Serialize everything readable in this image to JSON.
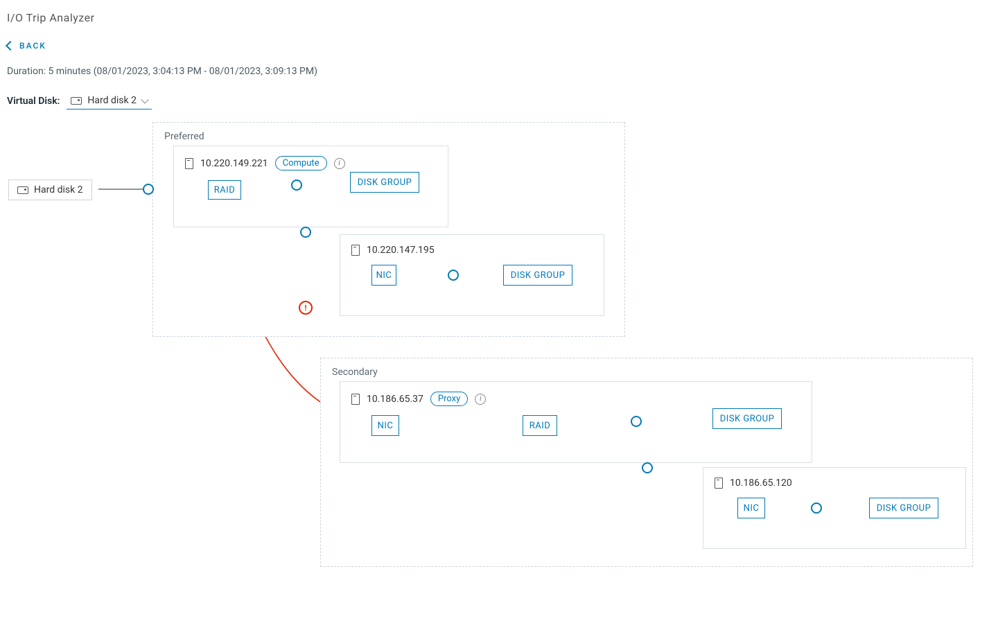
{
  "page_title": "I/O Trip Analyzer",
  "back_label": "BACK",
  "duration_text": "Duration: 5 minutes (08/01/2023, 3:04:13 PM - 08/01/2023, 3:09:13 PM)",
  "vd_label": "Virtual Disk:",
  "vd_selected": "Hard disk 2",
  "source_disk": "Hard disk 2",
  "groups": {
    "preferred": {
      "label": "Preferred"
    },
    "secondary": {
      "label": "Secondary"
    }
  },
  "hosts": {
    "h1": {
      "ip": "10.220.149.221",
      "role": "Compute"
    },
    "h2": {
      "ip": "10.220.147.195"
    },
    "h3": {
      "ip": "10.186.65.37",
      "role": "Proxy"
    },
    "h4": {
      "ip": "10.186.65.120"
    }
  },
  "nodes": {
    "raid": "RAID",
    "nic": "NIC",
    "dgroup": "DISK GROUP"
  }
}
